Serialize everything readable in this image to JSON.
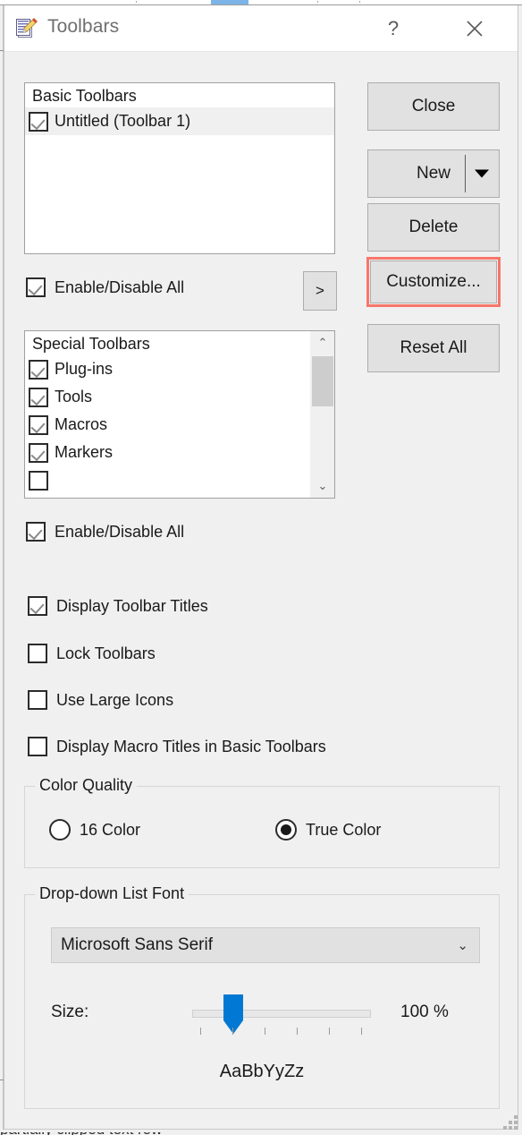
{
  "window": {
    "title": "Toolbars",
    "icon": "notepad-pencil-icon",
    "help_label": "?",
    "close_label": "✕"
  },
  "basic_toolbars": {
    "header": "Basic Toolbars",
    "items": [
      {
        "label": "Untitled (Toolbar 1)",
        "checked": true,
        "selected": true
      }
    ],
    "enable_all_label": "Enable/Disable All",
    "enable_all_checked": true,
    "expand_button_label": ">"
  },
  "special_toolbars": {
    "header": "Special Toolbars",
    "items": [
      {
        "label": "Plug-ins",
        "checked": true
      },
      {
        "label": "Tools",
        "checked": true
      },
      {
        "label": "Macros",
        "checked": true
      },
      {
        "label": "Markers",
        "checked": true
      }
    ],
    "enable_all_label": "Enable/Disable All",
    "enable_all_checked": true,
    "scroll_up_glyph": "⌃",
    "scroll_down_glyph": "⌄"
  },
  "options": [
    {
      "label": "Display Toolbar Titles",
      "checked": true
    },
    {
      "label": "Lock Toolbars",
      "checked": false
    },
    {
      "label": "Use Large Icons",
      "checked": false
    },
    {
      "label": "Display Macro Titles in Basic Toolbars",
      "checked": false
    }
  ],
  "buttons": {
    "close": "Close",
    "new": "New",
    "delete": "Delete",
    "customize": "Customize...",
    "reset_all": "Reset All",
    "highlighted": "customize",
    "highlight_color": "#f8766a"
  },
  "color_quality": {
    "title": "Color Quality",
    "options": [
      {
        "label": "16 Color",
        "selected": false
      },
      {
        "label": "True Color",
        "selected": true
      }
    ]
  },
  "dropdown_font": {
    "title": "Drop-down List Font",
    "font_value": "Microsoft Sans Serif",
    "chevron": "⌄",
    "size_label": "Size:",
    "size_percent": "100 %",
    "preview": "AaBbYyZz",
    "tick_count": 6
  },
  "bottom_bleed_text": "partially clipped text row"
}
